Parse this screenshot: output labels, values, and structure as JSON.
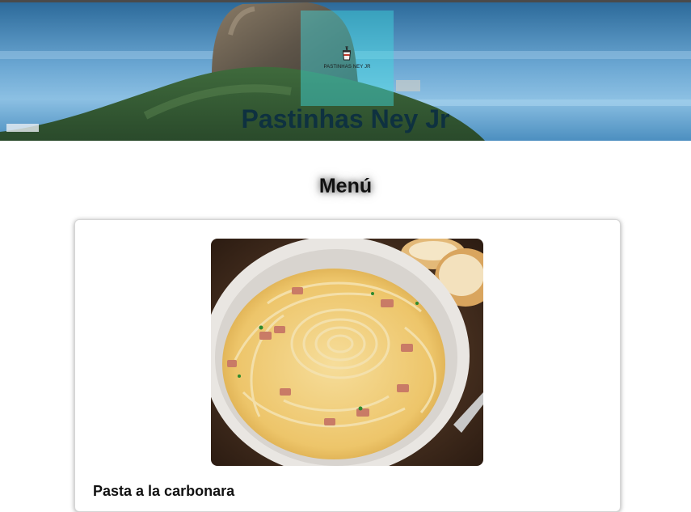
{
  "header": {
    "logo_text": "PASTINHAS NEY JR",
    "title": "Pastinhas Ney Jr"
  },
  "menu": {
    "heading": "Menú",
    "items": [
      {
        "name": "Pasta a la carbonara"
      }
    ]
  },
  "colors": {
    "title_text": "#0e3140",
    "logo_overlay": "#40dce1",
    "heading_text": "#111111"
  }
}
